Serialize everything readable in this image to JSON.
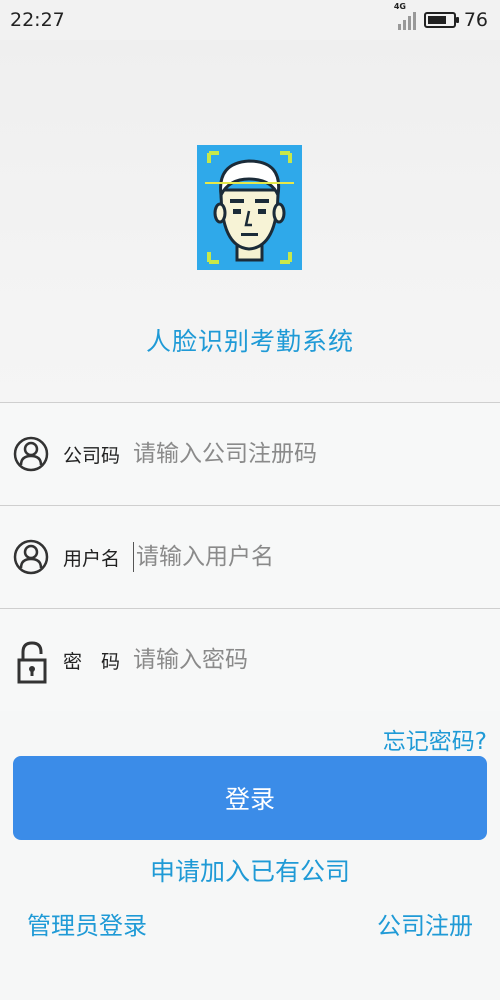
{
  "status_bar": {
    "time": "22:27",
    "network": "4G",
    "battery": "76",
    "battery_level": 0.76
  },
  "app": {
    "title": "人脸识别考勤系统",
    "logo_icon": "face-scan-icon",
    "logo_color": "#2fa9ea"
  },
  "form": {
    "company": {
      "label": "公司码",
      "placeholder": "请输入公司注册码",
      "value": "",
      "icon": "user-circle-icon"
    },
    "username": {
      "label": "用户名",
      "placeholder": "请输入用户名",
      "value": "",
      "icon": "user-circle-icon"
    },
    "password": {
      "label": "密　码",
      "placeholder": "请输入密码",
      "value": "",
      "icon": "lock-icon"
    }
  },
  "actions": {
    "forgot_password": "忘记密码?",
    "login": "登录",
    "join_company": "申请加入已有公司",
    "admin_login": "管理员登录",
    "company_register": "公司注册"
  },
  "colors": {
    "accent": "#1f9ad6",
    "button": "#3b8ce8"
  }
}
